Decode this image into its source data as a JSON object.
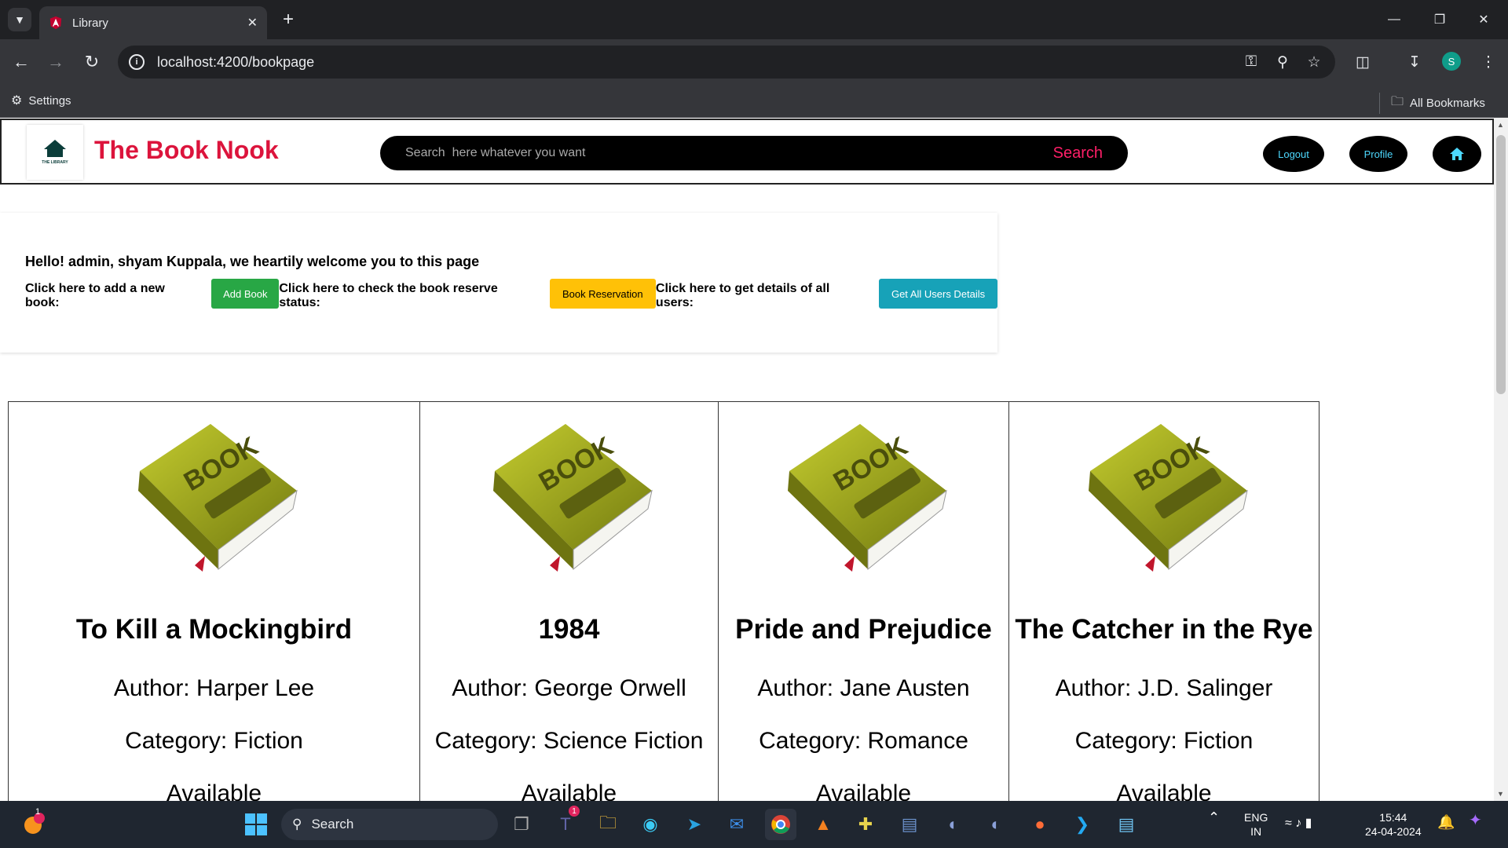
{
  "browser": {
    "tab_title": "Library",
    "url": "localhost:4200/bookpage",
    "bookmarks": {
      "settings": "Settings",
      "all_bookmarks": "All Bookmarks"
    },
    "profile_initial": "S"
  },
  "navbar": {
    "logo_text": "THE LIBRARY",
    "brand": "The Book Nook",
    "search_placeholder": "Search  here whatever you want",
    "search_button": "Search",
    "logout": "Logout",
    "profile": "Profile"
  },
  "welcome": {
    "heading": "Hello! admin, shyam Kuppala, we heartily welcome you to this page",
    "add_prompt": "Click here to add a new book:",
    "add_button": "Add Book",
    "reserve_prompt": "Click here to check the book reserve status:",
    "reserve_button": "Book Reservation",
    "users_prompt": "Click here to get details of all users:",
    "users_button": "Get All Users Details",
    "colors": {
      "add": "#28a745",
      "reserve": "#ffc107",
      "users": "#17a2b8"
    }
  },
  "books": [
    {
      "title": "To Kill a Mockingbird",
      "author": "Author: Harper Lee",
      "category": "Category: Fiction",
      "status": "Available",
      "cover_text": "BOOK"
    },
    {
      "title": "1984",
      "author": "Author: George Orwell",
      "category": "Category: Science Fiction",
      "status": "Available",
      "cover_text": "BOOK"
    },
    {
      "title": "Pride and Prejudice",
      "author": "Author: Jane Austen",
      "category": "Category: Romance",
      "status": "Available",
      "cover_text": "BOOK"
    },
    {
      "title": "The Catcher in the Rye",
      "author": "Author: J.D. Salinger",
      "category": "Category: Fiction",
      "status": "Available",
      "cover_text": "BOOK"
    }
  ],
  "taskbar": {
    "search": "Search",
    "lang": "ENG",
    "region": "IN",
    "time": "15:44",
    "date": "24-04-2024",
    "notif_badge": "1",
    "teams_badge": "1"
  }
}
